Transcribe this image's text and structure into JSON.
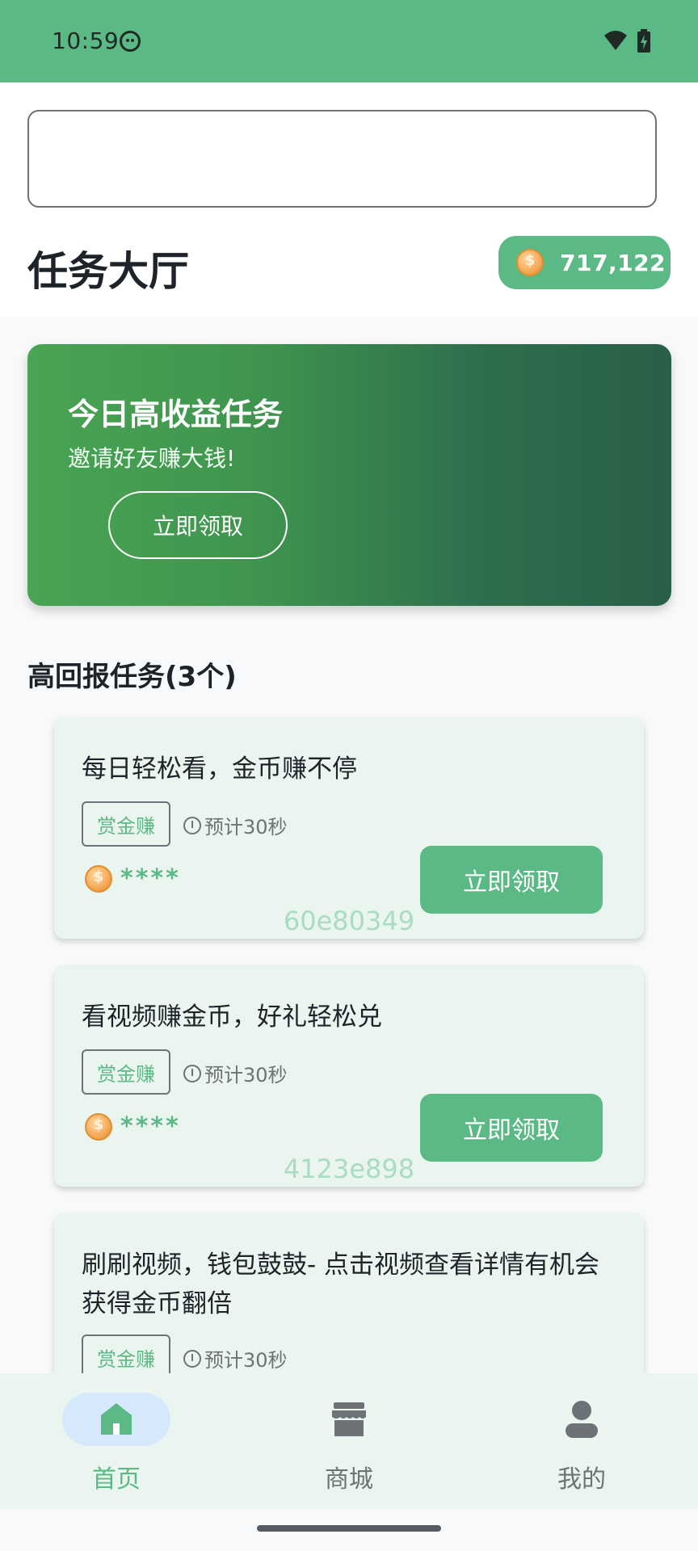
{
  "status_bar": {
    "time": "10:59"
  },
  "search": {
    "value": "",
    "placeholder": ""
  },
  "header": {
    "title": "任务大厅",
    "coin_balance": "717,122"
  },
  "banner": {
    "title": "今日高收益任务",
    "subtitle": "邀请好友赚大钱!",
    "button_label": "立即领取"
  },
  "section": {
    "title": "高回报任务(3个)"
  },
  "tasks": [
    {
      "title": "每日轻松看，金币赚不停",
      "tag": "赏金赚",
      "time": "预计30秒",
      "reward": "****",
      "button": "立即领取",
      "id": "60e80349"
    },
    {
      "title": "看视频赚金币，好礼轻松兑",
      "tag": "赏金赚",
      "time": "预计30秒",
      "reward": "****",
      "button": "立即领取",
      "id": "4123e898"
    },
    {
      "title": "刷刷视频，钱包鼓鼓- 点击视频查看详情有机会获得金币翻倍",
      "tag": "赏金赚",
      "time": "预计30秒"
    }
  ],
  "nav": [
    {
      "label": "首页",
      "icon": "home-icon",
      "active": true
    },
    {
      "label": "商城",
      "icon": "store-icon",
      "active": false
    },
    {
      "label": "我的",
      "icon": "person-icon",
      "active": false
    }
  ],
  "colors": {
    "primary": "#5bb985",
    "banner_start": "#49a453",
    "banner_end": "#295f47",
    "card_bg": "#eaf5ef",
    "nav_active_bg": "#d6e8fb"
  }
}
